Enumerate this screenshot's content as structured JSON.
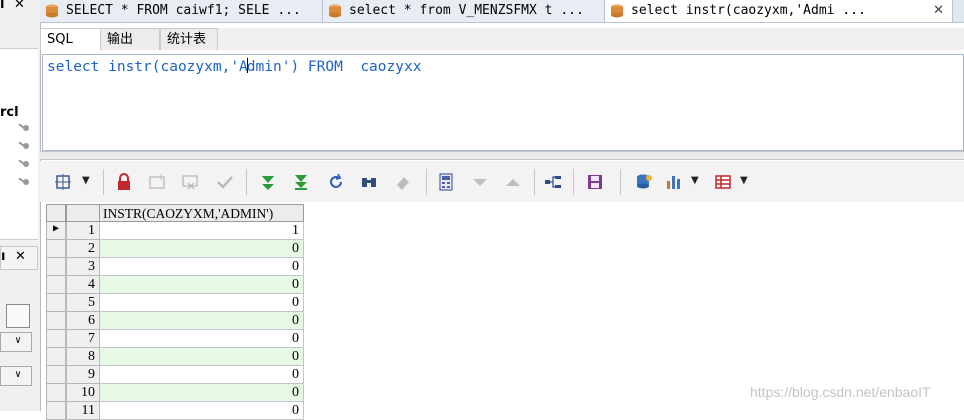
{
  "tabs": [
    {
      "label": "SELECT * FROM caiwf1; SELE ...",
      "active": false
    },
    {
      "label": "select * from V_MENZSFMX t ...",
      "active": false
    },
    {
      "label": "select instr(caozyxm,'Admi ...",
      "active": true,
      "close": "✕"
    }
  ],
  "left": {
    "frag_top": "l",
    "frag_mid": "rcl",
    "frag_panel2": "ı",
    "frag_close": "✕"
  },
  "subtabs": [
    "SQL",
    "输出",
    "统计表"
  ],
  "editor": {
    "sql_pre1": "select instr(caozyxm,'A",
    "sql_post1": "dmin')",
    "sql_from": "FROM",
    "sql_table": "caozyxx"
  },
  "toolbar": {
    "icons": [
      "query-builder-icon",
      "lock-icon",
      "new-record-icon",
      "delete-record-icon",
      "post-changes-icon",
      "fetch-next-icon",
      "fetch-last-icon",
      "refresh-icon",
      "find-icon",
      "clear-icon",
      "calculator-icon",
      "arrow-down-icon",
      "arrow-up-icon",
      "export-tree-icon",
      "save-icon",
      "database-icon",
      "chart-icon",
      "grid-table-icon"
    ],
    "dropdown": "▼"
  },
  "grid": {
    "column": "INSTR(CAOZYXM,'ADMIN')",
    "rows": [
      {
        "num": "1",
        "value": "1"
      },
      {
        "num": "2",
        "value": "0"
      },
      {
        "num": "3",
        "value": "0"
      },
      {
        "num": "4",
        "value": "0"
      },
      {
        "num": "5",
        "value": "0"
      },
      {
        "num": "6",
        "value": "0"
      },
      {
        "num": "7",
        "value": "0"
      },
      {
        "num": "8",
        "value": "0"
      },
      {
        "num": "9",
        "value": "0"
      },
      {
        "num": "10",
        "value": "0"
      },
      {
        "num": "11",
        "value": "0"
      }
    ],
    "current_marker": "▶"
  },
  "watermark": "https://blog.csdn.net/enbaoIT",
  "colors": {
    "keyword": "#1b63c6",
    "alt_row": "#e5f9e5"
  }
}
